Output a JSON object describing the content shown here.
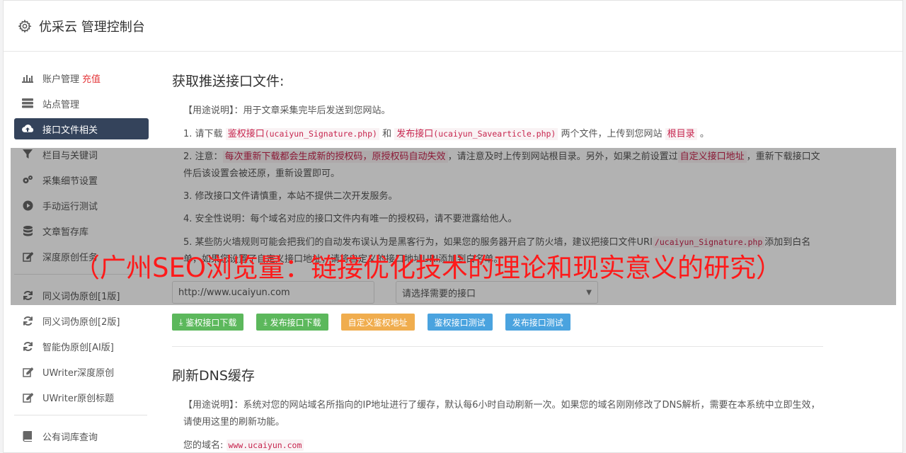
{
  "app": {
    "title": "优采云 管理控制台"
  },
  "sidebar": {
    "items": [
      {
        "label": "账户管理",
        "badge": "充值",
        "icon": "bar-chart-icon"
      },
      {
        "label": "站点管理",
        "icon": "server-icon"
      },
      {
        "label": "接口文件相关",
        "icon": "cloud-upload-icon",
        "active": true
      },
      {
        "label": "栏目与关键词",
        "icon": "filter-icon"
      },
      {
        "label": "采集细节设置",
        "icon": "cogs-icon"
      },
      {
        "label": "手动运行测试",
        "icon": "play-circle-icon"
      },
      {
        "label": "文章暂存库",
        "icon": "database-icon"
      },
      {
        "label": "深度原创任务",
        "icon": "edit-icon"
      }
    ],
    "items2": [
      {
        "label": "同义词伪原创[1版]",
        "icon": "refresh-icon"
      },
      {
        "label": "同义词伪原创[2版]",
        "icon": "refresh-icon"
      },
      {
        "label": "智能伪原创[AI版]",
        "icon": "refresh-icon"
      },
      {
        "label": "UWriter深度原创",
        "icon": "edit-icon"
      },
      {
        "label": "UWriter原创标题",
        "icon": "edit-icon"
      }
    ],
    "items3": [
      {
        "label": "公有词库查询",
        "icon": "book-icon"
      }
    ]
  },
  "section1": {
    "title": "获取推送接口文件:",
    "usage_label": "【用途说明】",
    "usage_text": "：用于文章采集完毕后发送到您网站。",
    "p1": {
      "a": "1. 请下载",
      "sig_label": "鉴权接口",
      "sig_file": "(ucaiyun_Signature.php)",
      "and": "和",
      "pub_label": "发布接口",
      "pub_file": "(ucaiyun_Savearticle.php)",
      "b": "两个文件，上传到您网站",
      "root": "根目录",
      "c": "。"
    },
    "p2": {
      "a": "2. 注意：",
      "warn": "每次重新下载都会生成新的授权码，原授权码自动失效",
      "b": "，请注意及时上传到网站根目录。另外，如果之前设置过",
      "custom": "自定义接口地址",
      "c": "，重新下载接口文件后该设置会被还原，重新设置即可。"
    },
    "p3": "3. 修改接口文件请慎重，本站不提供二次开发服务。",
    "p4": "4. 安全性说明：每个域名对应的接口文件内有唯一的授权码，请不要泄露给他人。",
    "p5": {
      "a": "5. 某些防火墙规则可能会把我们的自动发布误认为是黑客行为，如果您的服务器开启了防火墙，建议把接口文件URI",
      "uri": "/ucaiyun_Signature.php",
      "b": "添加到白名单，如果您设置了自定义接口地址，请将自定义的接口地址URI添加到白名单。"
    },
    "domain_input": "http://www.ucaiyun.com",
    "iface_select": "请选择需要的接口",
    "buttons": {
      "sig_download": "鉴权接口下载",
      "pub_download": "发布接口下载",
      "custom_sig": "自定义鉴权地址",
      "sig_test": "鉴权接口测试",
      "pub_test": "发布接口测试"
    }
  },
  "section2": {
    "title": "刷新DNS缓存",
    "usage_label": "【用途说明】",
    "usage_text": "：系统对您的网站域名所指向的IP地址进行了缓存，默认每6小时自动刷新一次。如果您的域名刚刚修改了DNS解析，需要在本系统中立即生效，请使用这里的刷新功能。",
    "domain_label": "您的域名:",
    "domain_value": "www.ucaiyun.com"
  },
  "banner": {
    "text": "（广州SEO浏览量：链接优化技术的理论和现实意义的研究）"
  },
  "colors": {
    "sidebar_active": "#34435b",
    "green": "#5cb85c",
    "orange": "#f0ad4e",
    "blue": "#4aa3df",
    "code_red": "#c7254e",
    "banner_red": "#ff1a1a"
  }
}
